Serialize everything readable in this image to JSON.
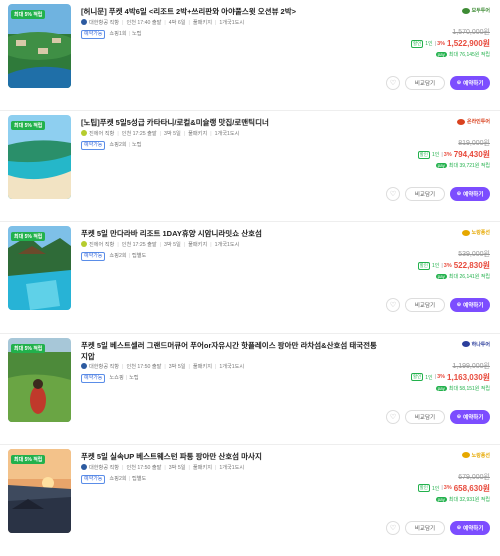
{
  "products": [
    {
      "badge": "최대 5% 적립",
      "title": "[허니문] 푸켓 4박6일 <리조트 2박+쓰리판와 아야풀스윗 오션뷰 2박>",
      "airline": "대한항공 직항",
      "departure": "인천 17:40 출발",
      "duration": "4박 6일",
      "package": "풀패키지",
      "cities": "1개국1도시",
      "tag": "예약가능",
      "shop": "쇼핑1회",
      "extra": "노팁",
      "agency": "모두투어",
      "agency_color": "#3d8b34",
      "airline_color": "#2c5aa0",
      "orig_price": "1,570,000원",
      "chip": "할인",
      "one": "1인",
      "pct": "3%",
      "price": "1,522,900원",
      "pay": "pay",
      "reward": "최대 76,145원 적립",
      "compare_label": "비교담기",
      "reserve_label": "예약하기",
      "image": "resort"
    },
    {
      "badge": "최대 5% 적립",
      "title": "[노팁]푸켓 5일5성급 카타타니/로컬&미슐랭 맛집/로맨틱디너",
      "airline": "진에어 직항",
      "departure": "인천 17:25 출발",
      "duration": "3박 5일",
      "package": "풀패키지",
      "cities": "1개국1도시",
      "tag": "예약가능",
      "shop": "쇼핑2회",
      "extra": "노팁",
      "agency": "온라인투어",
      "agency_color": "#d9421f",
      "airline_color": "#b6cc2e",
      "orig_price": "819,000원",
      "chip": "할인",
      "one": "1인",
      "pct": "3%",
      "price": "794,430원",
      "pay": "pay",
      "reward": "최대 39,721원 적립",
      "compare_label": "비교담기",
      "reserve_label": "예약하기",
      "image": "beach"
    },
    {
      "badge": "최대 5% 적립",
      "title": "푸켓 5일 만다라바 리조트 1DAY휴양 시암니라밋쇼 산호섬",
      "airline": "진에어 직항",
      "departure": "인천 17:25 출발",
      "duration": "3박 5일",
      "package": "풀패키지",
      "cities": "1개국1도시",
      "tag": "예약가능",
      "shop": "쇼핑2회",
      "extra": "팁별도",
      "agency": "노랑풍선",
      "agency_color": "#e6a800",
      "airline_color": "#b6cc2e",
      "orig_price": "539,000원",
      "chip": "할인",
      "one": "1인",
      "pct": "3%",
      "price": "522,830원",
      "pay": "pay",
      "reward": "최대 26,141원 적립",
      "compare_label": "비교담기",
      "reserve_label": "예약하기",
      "image": "pool"
    },
    {
      "badge": "최대 5% 적립",
      "title": "푸켓 5일 베스트셀러 그랜드머큐어 푸어or자유시간 핫플레이스 팡아만 라차섬&산호섬 태국전통지압",
      "airline": "대한항공 직항",
      "departure": "인천 17:50 출발",
      "duration": "3박 5일",
      "package": "풀패키지",
      "cities": "1개국1도시",
      "tag": "예약가능",
      "shop": "노쇼핑",
      "extra": "노팁",
      "agency": "하나투어",
      "agency_color": "#2c3e9c",
      "airline_color": "#2c5aa0",
      "orig_price": "1,199,000원",
      "chip": "할인",
      "one": "1인",
      "pct": "3%",
      "price": "1,163,030원",
      "pay": "pay",
      "reward": "최대 58,151원 적립",
      "compare_label": "비교담기",
      "reserve_label": "예약하기",
      "image": "terrace"
    },
    {
      "badge": "최대 5% 적립",
      "title": "푸켓 5일 실속UP 베스트웨스턴 파통 팡아만 산호섬 마사지",
      "airline": "대한항공 직항",
      "departure": "인천 17:50 출발",
      "duration": "3박 5일",
      "package": "풀패키지",
      "cities": "1개국1도시",
      "tag": "예약가능",
      "shop": "쇼핑2회",
      "extra": "팁별도",
      "agency": "노랑풍선",
      "agency_color": "#e6a800",
      "airline_color": "#2c5aa0",
      "orig_price": "679,000원",
      "chip": "할인",
      "one": "1인",
      "pct": "3%",
      "price": "658,630원",
      "pay": "pay",
      "reward": "최대 32,931원 적립",
      "compare_label": "비교담기",
      "reserve_label": "예약하기",
      "image": "sunset"
    }
  ]
}
